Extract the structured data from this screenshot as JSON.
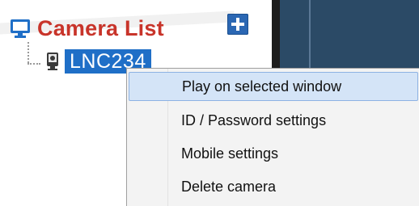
{
  "camera_tree": {
    "title": "Camera List",
    "header_icon": "monitor-icon",
    "add_button_icon": "plus-icon",
    "items": [
      {
        "label": "LNC234",
        "icon": "camera-icon",
        "selected": true
      }
    ]
  },
  "context_menu": {
    "items": [
      {
        "label": "Play on selected window",
        "highlighted": true
      },
      {
        "label": "ID / Password settings"
      },
      {
        "label": "Mobile settings"
      },
      {
        "label": "Delete camera"
      }
    ]
  },
  "colors": {
    "title_red": "#c8342a",
    "selection_blue": "#1f6fc7",
    "add_button_blue": "#2b67b3",
    "menu_hover": "#d4e4f7",
    "video_pane": "#2b4a66"
  }
}
